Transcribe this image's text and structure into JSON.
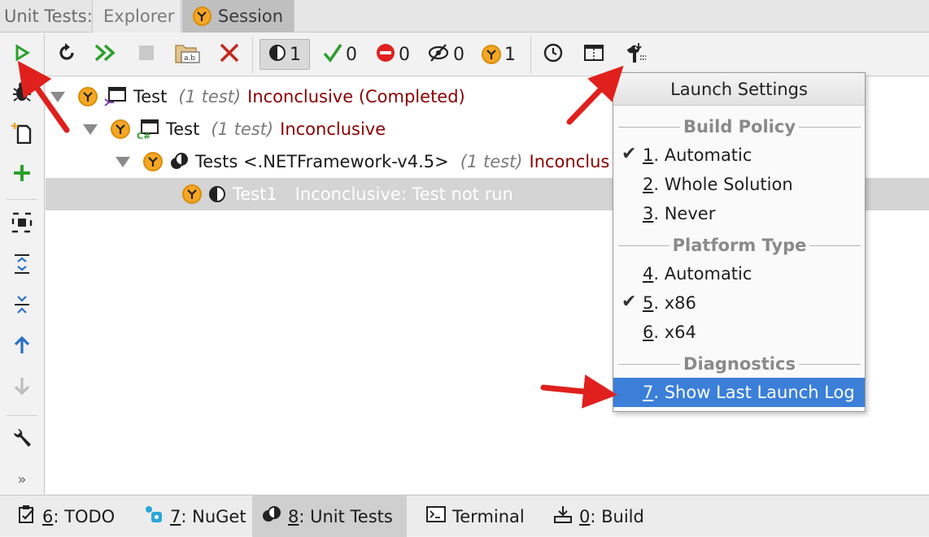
{
  "tabbar": {
    "label": "Unit Tests:",
    "tabs": [
      {
        "label": "Explorer"
      },
      {
        "label": "Session"
      }
    ]
  },
  "toolbar": {
    "counts": {
      "inconclusive_total": "1",
      "passed": "0",
      "failed": "0",
      "ignored": "0",
      "unknown": "1"
    }
  },
  "tree": {
    "rows": [
      {
        "name": "Test",
        "count": "(1 test)",
        "status": "Inconclusive (Completed)"
      },
      {
        "name": "Test",
        "count": "(1 test)",
        "status": "Inconclusive"
      },
      {
        "name": "Tests <.NETFramework-v4.5>",
        "count": "(1 test)",
        "status": "Inconclus"
      },
      {
        "name": "Test1",
        "status": "Inconclusive: Test not run"
      }
    ]
  },
  "menu": {
    "title": "Launch Settings",
    "groups": [
      {
        "title": "Build Policy"
      },
      {
        "title": "Platform Type"
      },
      {
        "title": "Diagnostics"
      }
    ],
    "items": [
      {
        "key": "1",
        "label": ". Automatic"
      },
      {
        "key": "2",
        "label": ". Whole Solution"
      },
      {
        "key": "3",
        "label": ". Never"
      },
      {
        "key": "4",
        "label": ". Automatic"
      },
      {
        "key": "5",
        "label": ". x86"
      },
      {
        "key": "6",
        "label": ". x64"
      },
      {
        "key": "7",
        "label": ". Show Last Launch Log"
      }
    ]
  },
  "bottombar": {
    "items": [
      {
        "key": "6",
        "label": ": TODO"
      },
      {
        "key": "7",
        "label": ": NuGet"
      },
      {
        "key": "8",
        "label": ": Unit Tests"
      },
      {
        "key": "",
        "label": "Terminal"
      },
      {
        "key": "0",
        "label": ": Build"
      }
    ]
  },
  "colors": {
    "accent": "#3b7fd9",
    "status_red": "#8b0000",
    "badge": "#f5a623",
    "pass": "#2e9e2e",
    "fail": "#e02020",
    "arrow": "#e0201c"
  }
}
